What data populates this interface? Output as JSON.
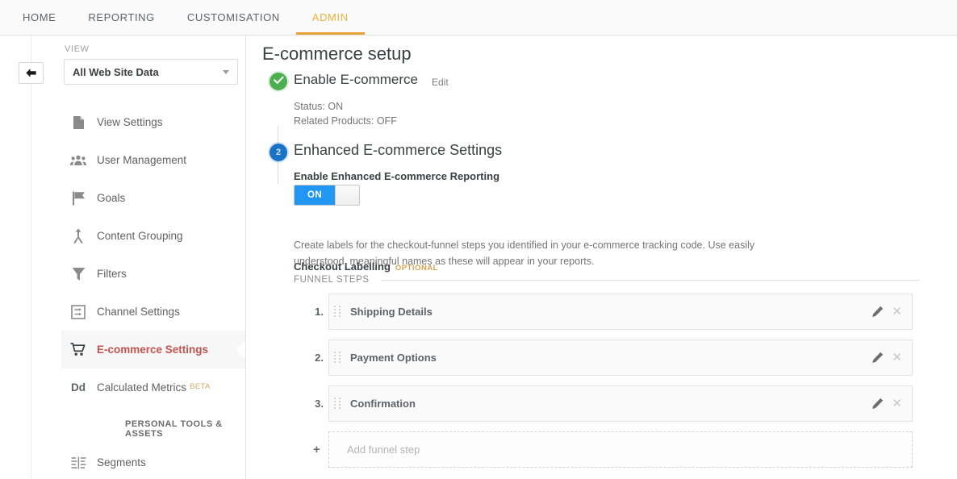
{
  "topnav": {
    "tabs": [
      {
        "label": "HOME",
        "active": false
      },
      {
        "label": "REPORTING",
        "active": false
      },
      {
        "label": "CUSTOMISATION",
        "active": false
      },
      {
        "label": "ADMIN",
        "active": true
      }
    ],
    "active_color": "#e8a33d"
  },
  "rail": {
    "back_label": "back-arrow"
  },
  "sidebar": {
    "view_label": "VIEW",
    "view_value": "All Web Site Data",
    "items": [
      {
        "label": "View Settings",
        "icon": "document-icon",
        "active": false
      },
      {
        "label": "User Management",
        "icon": "people-icon",
        "active": false
      },
      {
        "label": "Goals",
        "icon": "flag-icon",
        "active": false
      },
      {
        "label": "Content Grouping",
        "icon": "content-grouping-icon",
        "active": false
      },
      {
        "label": "Filters",
        "icon": "funnel-icon",
        "active": false
      },
      {
        "label": "Channel Settings",
        "icon": "channel-icon",
        "active": false
      },
      {
        "label": "E-commerce Settings",
        "icon": "shopping-cart-icon",
        "active": true
      },
      {
        "label": "Calculated Metrics",
        "icon": "dd-icon",
        "active": false,
        "badge": "BETA"
      }
    ],
    "section_header": "PERSONAL TOOLS & ASSETS",
    "personal_items": [
      {
        "label": "Segments",
        "icon": "segments-icon",
        "active": false
      }
    ],
    "active_color": "#c2534e",
    "beta_color": "#c9ab6a"
  },
  "main": {
    "page_title": "E-commerce setup",
    "step1": {
      "marker": "check-icon",
      "title": "Enable E-commerce",
      "edit_label": "Edit",
      "status_line1": "Status: ON",
      "status_line2": "Related Products: OFF",
      "marker_color": "#4caf50"
    },
    "step2": {
      "marker_number": "2",
      "marker_color": "#1a73c4",
      "title": "Enhanced E-commerce Settings",
      "toggle_label": "Enable Enhanced E-commerce Reporting",
      "toggle_state": "ON",
      "toggle_color": "#2196f3",
      "checkout_heading": "Checkout Labelling",
      "checkout_badge": "OPTIONAL",
      "checkout_badge_color": "#d4a354",
      "checkout_description": "Create labels for the checkout-funnel steps you identified in your e-commerce tracking code. Use easily understood, meaningful names as these will appear in your reports.",
      "funnel_section_label": "FUNNEL STEPS",
      "funnel_steps": [
        {
          "number": "1.",
          "name": "Shipping Details"
        },
        {
          "number": "2.",
          "name": "Payment Options"
        },
        {
          "number": "3.",
          "name": "Confirmation"
        }
      ],
      "add_step_plus": "+",
      "add_step_placeholder": "Add funnel step",
      "row_edit_icon": "pencil-icon",
      "row_delete_icon": "close-icon"
    }
  }
}
